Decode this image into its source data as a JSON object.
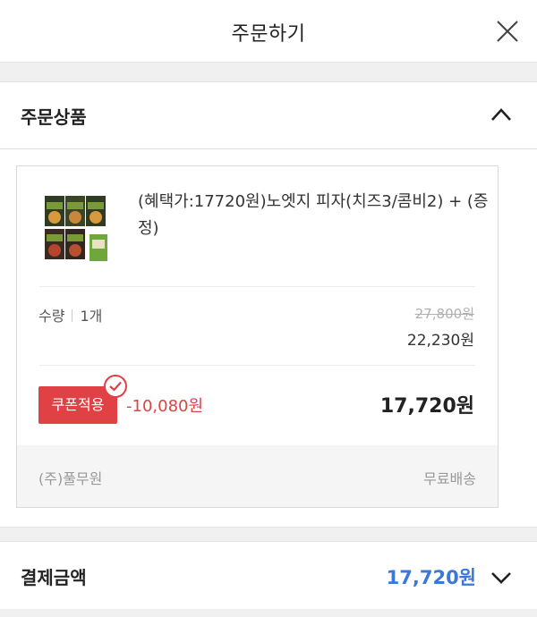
{
  "header": {
    "title": "주문하기"
  },
  "order_section": {
    "title": "주문상품"
  },
  "product": {
    "name": "(혜택가:17720원)노엣지 피자(치즈3/콤비2) + (증정)",
    "quantity_label": "수량",
    "quantity_value": "1개",
    "original_price": "27,800원",
    "sale_price": "22,230원",
    "coupon_button_label": "쿠폰적용",
    "coupon_discount": "-10,080원",
    "final_price": "17,720원",
    "seller": "(주)풀무원",
    "shipping": "무료배송"
  },
  "payment": {
    "title": "결제금액",
    "amount": "17,720원"
  },
  "colors": {
    "accent_red": "#df4144",
    "accent_blue": "#3b78d8"
  }
}
